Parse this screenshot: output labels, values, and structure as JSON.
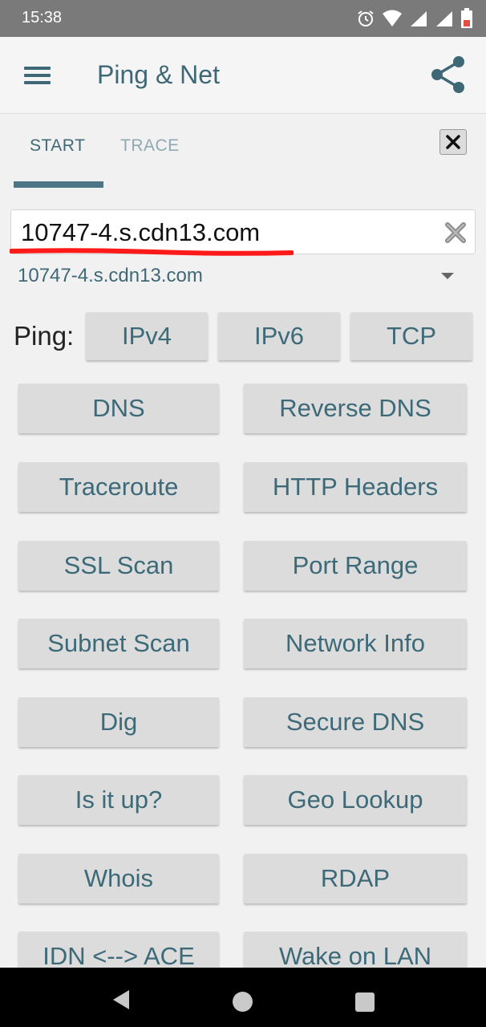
{
  "status_bar": {
    "time": "15:38",
    "icons": [
      "alarm-icon",
      "wifi-icon",
      "signal-icon",
      "signal-icon",
      "battery-icon"
    ]
  },
  "app_bar": {
    "title": "Ping & Net",
    "menu_icon": "menu-icon",
    "share_icon": "share-icon"
  },
  "tabs": [
    {
      "label": "START"
    },
    {
      "label": "TRACE"
    }
  ],
  "host": {
    "value": "10747-4.s.cdn13.com",
    "history_value": "10747-4.s.cdn13.com"
  },
  "ping": {
    "label": "Ping:",
    "buttons": [
      "IPv4",
      "IPv6",
      "TCP"
    ]
  },
  "tools": {
    "left": [
      "DNS",
      "Traceroute",
      "SSL Scan",
      "Subnet Scan",
      "Dig",
      "Is it up?",
      "Whois",
      "IDN <--> ACE"
    ],
    "right": [
      "Reverse DNS",
      "HTTP Headers",
      "Port Range",
      "Network Info",
      "Secure DNS",
      "Geo Lookup",
      "RDAP",
      "Wake on LAN"
    ]
  },
  "colors": {
    "accent": "#3f6877",
    "button_bg": "#dcdcdc",
    "underline": "#ff1a1a"
  }
}
